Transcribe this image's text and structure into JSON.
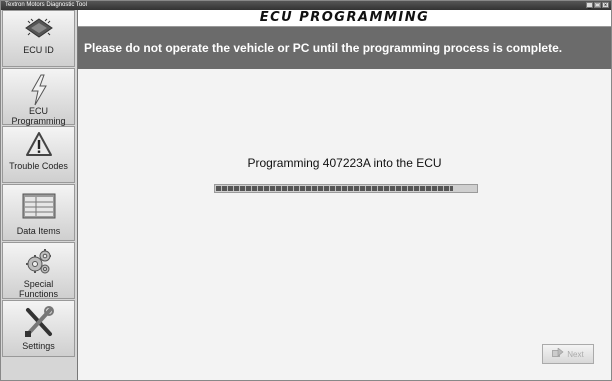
{
  "window": {
    "title": "Textron Motors Diagnostic Tool",
    "controls": [
      "_",
      "□",
      "×"
    ]
  },
  "sidebar": {
    "items": [
      {
        "label": "ECU ID",
        "icon": "chip-icon",
        "active": false
      },
      {
        "label": "ECU Programming",
        "icon": "lightning-icon",
        "active": true
      },
      {
        "label": "Trouble Codes",
        "icon": "warning-icon",
        "active": false
      },
      {
        "label": "Data Items",
        "icon": "data-grid-icon",
        "active": false
      },
      {
        "label": "Special Functions",
        "icon": "gears-icon",
        "active": false
      },
      {
        "label": "Settings",
        "icon": "tools-icon",
        "active": false
      }
    ]
  },
  "header": {
    "title": "ECU PROGRAMMING"
  },
  "banner": {
    "text": "Please do not operate the vehicle or PC until the programming process is complete."
  },
  "status": {
    "text": "Programming 407223A into the ECU"
  },
  "progress": {
    "percent": 91
  },
  "next_button": {
    "label": "Next",
    "enabled": false
  }
}
